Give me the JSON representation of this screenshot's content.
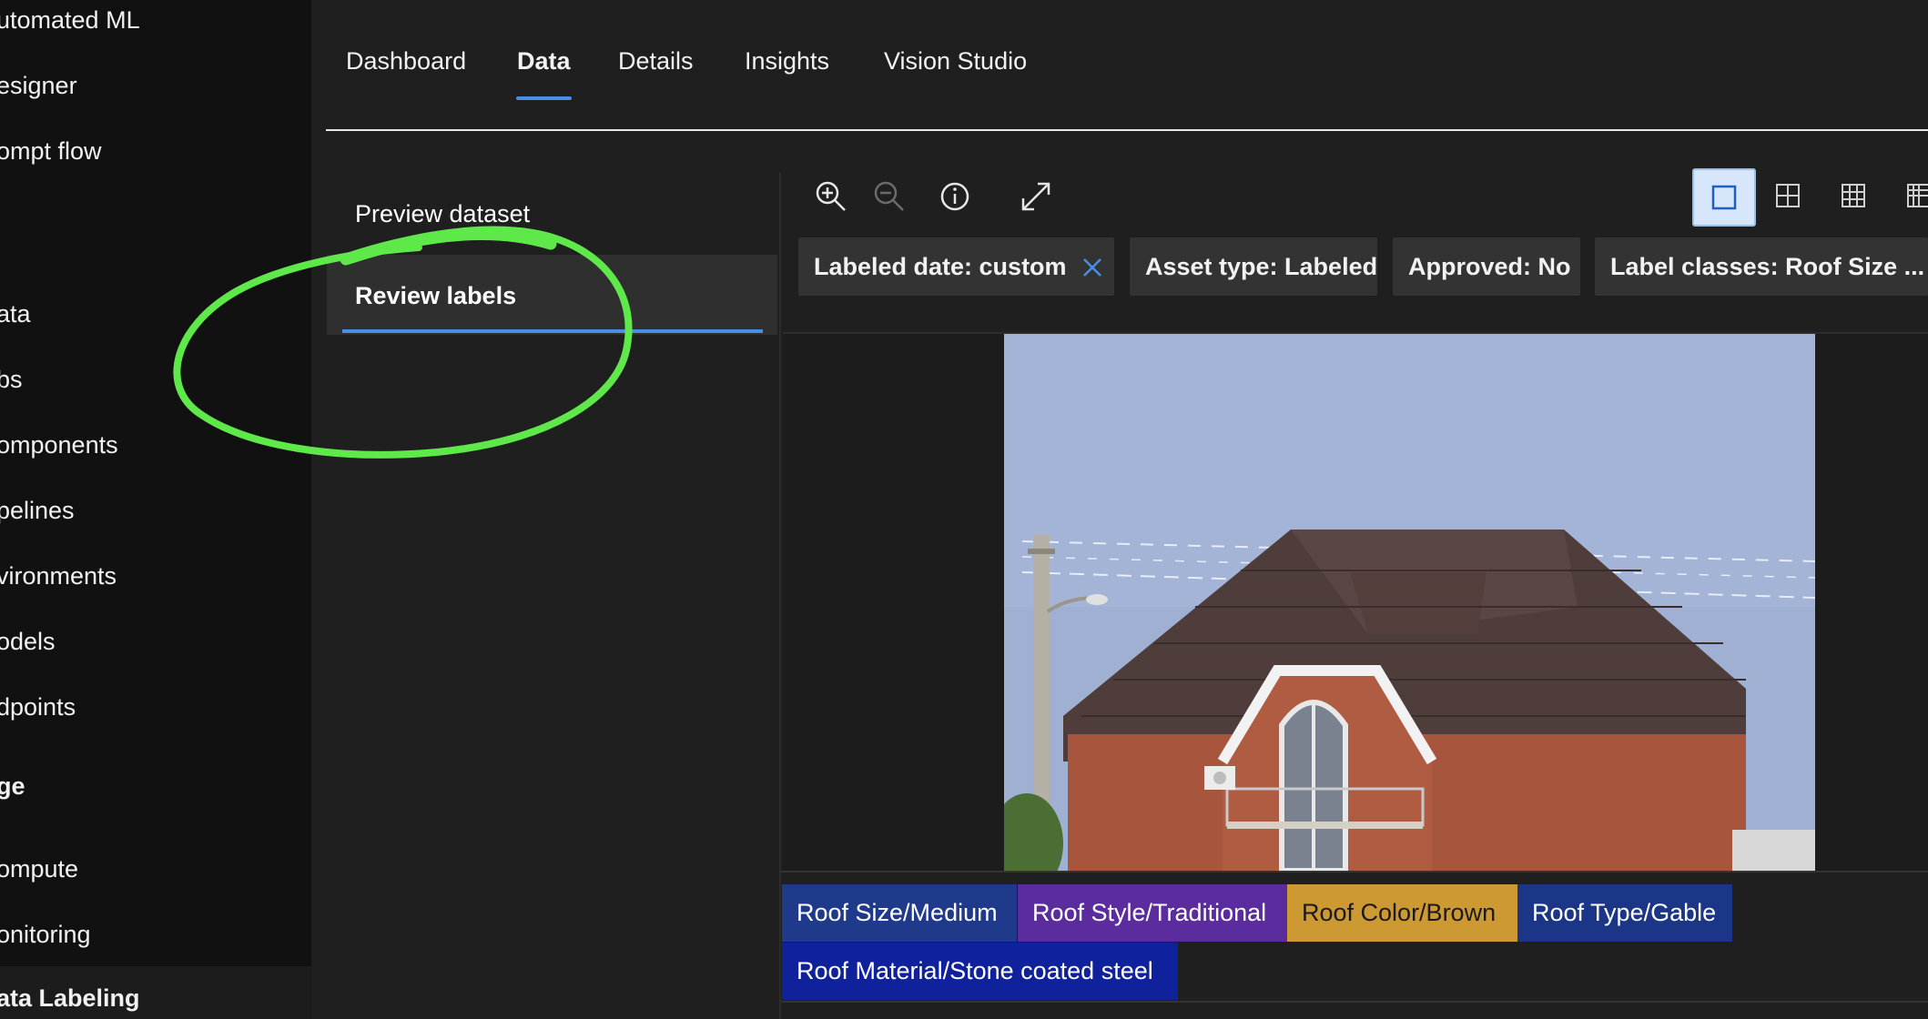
{
  "sidebar": {
    "items": [
      {
        "label": "utomated ML"
      },
      {
        "label": "esigner"
      },
      {
        "label": "ompt flow"
      },
      {
        "label": "ata"
      },
      {
        "label": "bs"
      },
      {
        "label": "omponents"
      },
      {
        "label": "pelines"
      },
      {
        "label": "vironments"
      },
      {
        "label": "odels"
      },
      {
        "label": "dpoints"
      },
      {
        "label": "ge"
      },
      {
        "label": "ompute"
      },
      {
        "label": "onitoring"
      },
      {
        "label": "ata Labeling"
      }
    ]
  },
  "tabs": [
    {
      "label": "Dashboard"
    },
    {
      "label": "Data"
    },
    {
      "label": "Details"
    },
    {
      "label": "Insights"
    },
    {
      "label": "Vision Studio"
    }
  ],
  "subnav": [
    {
      "label": "Preview dataset"
    },
    {
      "label": "Review labels"
    }
  ],
  "toolbar": {
    "icons": [
      "zoom-in-icon",
      "zoom-out-icon",
      "info-icon",
      "expand-icon"
    ],
    "view_modes": [
      "single-view-icon",
      "grid-2x2-icon",
      "grid-3x3-icon",
      "grid-4x4-icon"
    ]
  },
  "filters": [
    {
      "label": "Labeled date: custom"
    },
    {
      "label": "Asset type: Labeled"
    },
    {
      "label": "Approved: No"
    },
    {
      "label": "Label classes: Roof Size ..."
    }
  ],
  "tags": [
    {
      "label": "Roof Size/Medium",
      "color": "#1f3a8a"
    },
    {
      "label": "Roof Style/Traditional",
      "color": "#5b2c9e"
    },
    {
      "label": "Roof Color/Brown",
      "color": "#cc9933"
    },
    {
      "label": "Roof Type/Gable",
      "color": "#1c3687"
    },
    {
      "label": "Roof Material/Stone coated steel",
      "color": "#10229b"
    }
  ],
  "colors": {
    "accent": "#4a8ee6",
    "annotation": "#5ee84a"
  }
}
